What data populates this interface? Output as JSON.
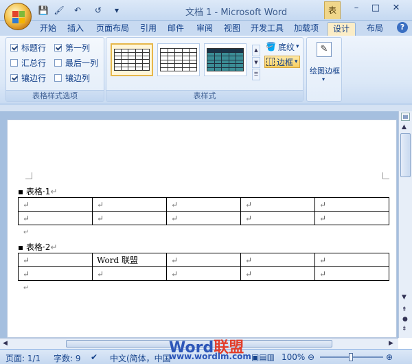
{
  "window": {
    "title": "文档 1 - Microsoft Word",
    "context_tab": "表",
    "controls": {
      "minimize": "–",
      "maximize": "□",
      "close": "✕"
    }
  },
  "quick_access": {
    "save": "💾",
    "undo": "↶",
    "redo": "↺"
  },
  "tabs": [
    "开始",
    "插入",
    "页面布局",
    "引用",
    "邮件",
    "审阅",
    "视图",
    "开发工具",
    "加载项",
    "设计",
    "布局"
  ],
  "active_tab": "设计",
  "help_label": "?",
  "ribbon": {
    "options_group": {
      "label": "表格样式选项",
      "items": [
        {
          "label": "标题行",
          "checked": true
        },
        {
          "label": "第一列",
          "checked": true
        },
        {
          "label": "汇总行",
          "checked": false
        },
        {
          "label": "最后一列",
          "checked": false
        },
        {
          "label": "镶边行",
          "checked": true
        },
        {
          "label": "镶边列",
          "checked": false
        }
      ]
    },
    "styles_group": {
      "label": "表样式",
      "shading_label": "底纹",
      "border_label": "边框"
    },
    "draw_group": {
      "label": "绘图边框"
    }
  },
  "document": {
    "caption1": "表格·1",
    "caption2": "表格·2",
    "cell_text": "Word 联盟",
    "para_mark": "↵"
  },
  "status": {
    "page": "页面: 1/1",
    "words": "字数: 9",
    "language": "中文(简体，中国",
    "zoom": "100%"
  },
  "watermark": {
    "brand": "Word",
    "brand2": "联盟",
    "url": "www.wordlm.com"
  },
  "colors": {
    "accent": "#15428b",
    "selected_style": "#e6b74a"
  }
}
